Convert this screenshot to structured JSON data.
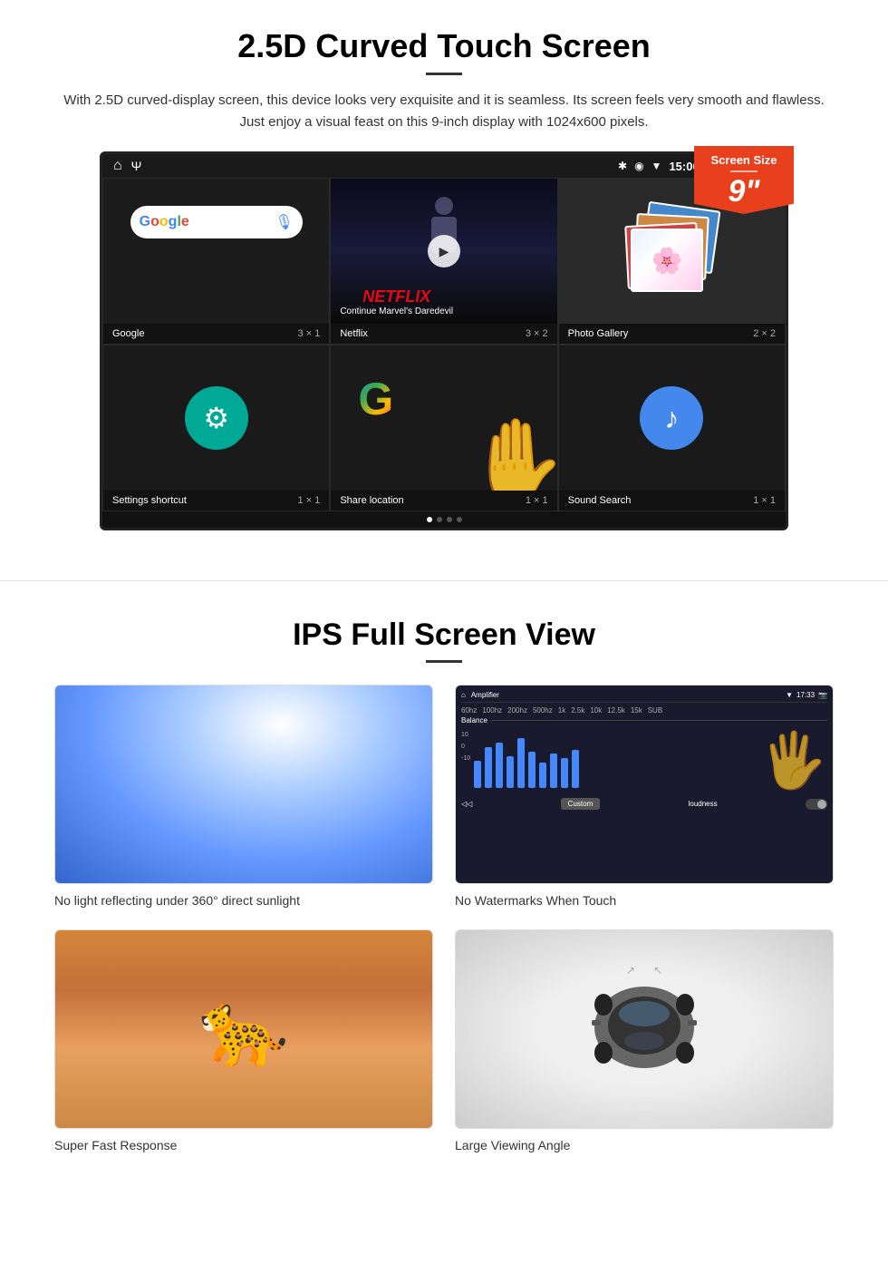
{
  "section1": {
    "title": "2.5D Curved Touch Screen",
    "description": "With 2.5D curved-display screen, this device looks very exquisite and it is seamless. Its screen feels very smooth and flawless. Just enjoy a visual feast on this 9-inch display with 1024x600 pixels.",
    "badge": {
      "label": "Screen Size",
      "size": "9",
      "inch_symbol": "\""
    },
    "status_bar": {
      "time": "15:06"
    },
    "apps": [
      {
        "name": "Google",
        "size": "3 × 1"
      },
      {
        "name": "Netflix",
        "size": "3 × 2"
      },
      {
        "name": "Photo Gallery",
        "size": "2 × 2"
      },
      {
        "name": "Settings shortcut",
        "size": "1 × 1"
      },
      {
        "name": "Share location",
        "size": "1 × 1"
      },
      {
        "name": "Sound Search",
        "size": "1 × 1"
      }
    ],
    "netflix_logo": "NETFLIX",
    "netflix_subtitle": "Continue Marvel's Daredevil"
  },
  "section2": {
    "title": "IPS Full Screen View",
    "features": [
      {
        "label": "No light reflecting under 360° direct sunlight",
        "img_type": "sunlight"
      },
      {
        "label": "No Watermarks When Touch",
        "img_type": "amplifier"
      },
      {
        "label": "Super Fast Response",
        "img_type": "cheetah"
      },
      {
        "label": "Large Viewing Angle",
        "img_type": "car"
      }
    ]
  }
}
